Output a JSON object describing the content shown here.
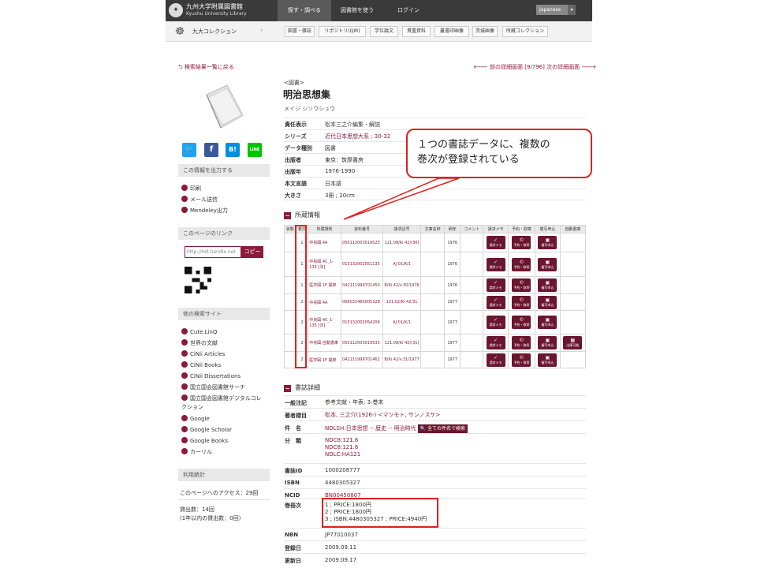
{
  "header": {
    "logo_line1": "九州大学附属図書館",
    "logo_line2": "Kyushu University Library",
    "nav": [
      "探す・調べる",
      "図書館を使う",
      "ログイン"
    ],
    "language": "Japanese"
  },
  "subnav": {
    "collection": "九大コレクション",
    "buttons": [
      "図書・雑誌",
      "リポジトリ(QIR)",
      "学位論文",
      "貴重資料",
      "叢書印画像",
      "茨城画像",
      "所蔵コレクション"
    ]
  },
  "navigation": {
    "back": "検索結果一覧に戻る",
    "detail": "前の詳細画面 [9/796] 次の詳細画面"
  },
  "sidebar": {
    "output_heading": "この情報を出力する",
    "output_items": [
      "印刷",
      "メール送信",
      "Mendeley出力"
    ],
    "link_heading": "このページのリンク",
    "url_value": "http://hdl.handle.net",
    "copy_label": "コピー",
    "other_heading": "他の検索サイト",
    "other_sites": [
      "Cute.LinQ",
      "世界の文献",
      "CiNii Articles",
      "CiNii Books",
      "CiNii Dissertations",
      "国立国会図書館サーチ",
      "国立国会図書館デジタルコレ",
      "クション",
      "Google",
      "Google Scholar",
      "Google Books",
      "カーリル"
    ],
    "stats_heading": "利用統計",
    "stats_access": "このページへのアクセス：29回",
    "stats_loans": "貸出数：14回",
    "stats_loans_year": "(1年以内の貸出数：0回)"
  },
  "record": {
    "type": "<図書>",
    "title": "明治思想集",
    "reading": "メイジ シソウシュウ",
    "meta": [
      {
        "k": "責任表示",
        "v": "松本三之介編集・解説"
      },
      {
        "k": "シリーズ",
        "v": "近代日本思想大系 ; 30-32"
      },
      {
        "k": "データ種別",
        "v": "図書"
      },
      {
        "k": "出版者",
        "v": "東京：筑摩書房"
      },
      {
        "k": "出版年",
        "v": "1976-1990"
      },
      {
        "k": "本文言語",
        "v": "日本語"
      },
      {
        "k": "大きさ",
        "v": "3冊 ; 20cm"
      }
    ]
  },
  "holdings": {
    "heading": "所蔵情報",
    "columns": [
      "状態",
      "巻次",
      "所蔵場所",
      "資料番号",
      "請求記号",
      "文庫名称",
      "刷年",
      "コメント",
      "請求メモ",
      "予約・取寄",
      "複写申込",
      "自動書庫"
    ],
    "rows": [
      {
        "vol": "1",
        "loc": "中央図 4A",
        "barcode": "050112003019523",
        "callno": "121.08/Ki 42/(30)",
        "year": "1976",
        "auto": ""
      },
      {
        "vol": "1",
        "loc": "中央図 4C_1-135 [法]",
        "barcode": "015132002051135",
        "callno": "AJ 01/K/1",
        "year": "1976",
        "auto": ""
      },
      {
        "vol": "1",
        "loc": "医学図 1F 開架",
        "barcode": "042111999701450",
        "callno": "B/Ki 42/v.30/1976",
        "year": "1976",
        "auto": ""
      },
      {
        "vol": "2",
        "loc": "中央図 4A",
        "barcode": "068031480005328",
        "callno": "121.02/Ki 42/31",
        "year": "1977",
        "auto": ""
      },
      {
        "vol": "2",
        "loc": "中央図 4C_1-135 [法]",
        "barcode": "015132002054206",
        "callno": "AJ 01/K/1",
        "year": "1977",
        "auto": ""
      },
      {
        "vol": "2",
        "loc": "中央図 自動書庫",
        "barcode": "050112003019535",
        "callno": "121.08/Ki 42/(31)",
        "year": "1977",
        "auto": "出庫可能"
      },
      {
        "vol": "2",
        "loc": "医学図 1F 開架",
        "barcode": "042111999701462",
        "callno": "B/Ki 42/v.31/1977",
        "year": "1977",
        "auto": ""
      }
    ],
    "btn_memo": "請求メモ",
    "btn_reserve": "予約・取寄",
    "btn_copy": "複写申込"
  },
  "details": {
    "heading": "書誌詳細",
    "general_note_k": "一般注記",
    "general_note_v": "参考文献・年表: 3:巻末",
    "author_k": "著者標目",
    "author_v": "松本, 三之介(1926-) <マツモト, サンノスケ>",
    "subject_k": "件　名",
    "subject_v": "NDLSH:日本思想 -- 歴史 -- 明治時代",
    "subject_btn": "全ての件名で検索",
    "class_k": "分　類",
    "class_v": [
      "NDC8:121.6",
      "NDC8:121.6",
      "NDLC:HA121"
    ],
    "bibid_k": "書誌ID",
    "bibid_v": "1000208777",
    "isbn_k": "ISBN",
    "isbn_v": "4480305327",
    "ncid_k": "NCID",
    "ncid_v": "BN00450807",
    "vol_k": "巻冊次",
    "vol_v": [
      "1 ; PRICE:1800円",
      "2 ; PRICE:1800円",
      "3 ; ISBN:4480305327 ; PRICE:4940円"
    ],
    "nbn_k": "NBN",
    "nbn_v": "JP77010037",
    "reg_k": "登録日",
    "reg_v": "2009.09.11",
    "upd_k": "更新日",
    "upd_v": "2009.09.17"
  },
  "annotation": {
    "callout_line1": "１つの書誌データに、複数の",
    "callout_line2": "巻次が登録されている"
  }
}
